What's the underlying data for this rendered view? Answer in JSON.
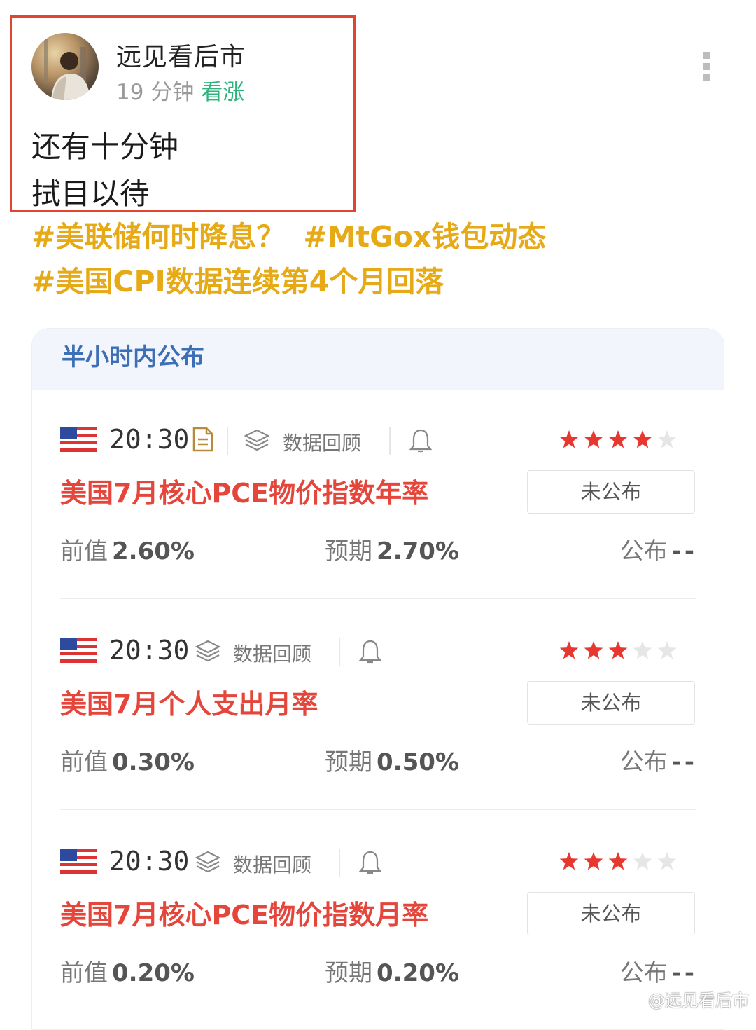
{
  "post": {
    "author": "远见看后市",
    "time_ago": "19 分钟",
    "sentiment": "看涨",
    "lines": [
      "还有十分钟",
      "拭目以待"
    ],
    "hashtags": [
      "#美联储何时降息？",
      "#MtGox钱包动态",
      "#美国CPI数据连续第4个月回落"
    ]
  },
  "calendar": {
    "header": "半小时内公布",
    "events": [
      {
        "time": "20:30",
        "has_doc": true,
        "review_label": "数据回顾",
        "stars": 4,
        "title": "美国7月核心PCE物价指数年率",
        "status": "未公布",
        "prev_label": "前值",
        "prev_value": "2.60%",
        "exp_label": "预期",
        "exp_value": "2.70%",
        "act_label": "公布",
        "act_value": "--"
      },
      {
        "time": "20:30",
        "has_doc": false,
        "review_label": "数据回顾",
        "stars": 3,
        "title": "美国7月个人支出月率",
        "status": "未公布",
        "prev_label": "前值",
        "prev_value": "0.30%",
        "exp_label": "预期",
        "exp_value": "0.50%",
        "act_label": "公布",
        "act_value": "--"
      },
      {
        "time": "20:30",
        "has_doc": false,
        "review_label": "数据回顾",
        "stars": 3,
        "title": "美国7月核心PCE物价指数月率",
        "status": "未公布",
        "prev_label": "前值",
        "prev_value": "0.20%",
        "exp_label": "预期",
        "exp_value": "0.20%",
        "act_label": "公布",
        "act_value": "--"
      }
    ]
  },
  "watermark": "@远见看后市",
  "colors": {
    "highlight": "#e0452f",
    "sentiment": "#2fb37d",
    "hashtag": "#e7aa17",
    "event_title": "#e5463b",
    "star_on": "#e8372f",
    "star_off": "#e6e6e6",
    "header_text": "#3c6fb6"
  }
}
